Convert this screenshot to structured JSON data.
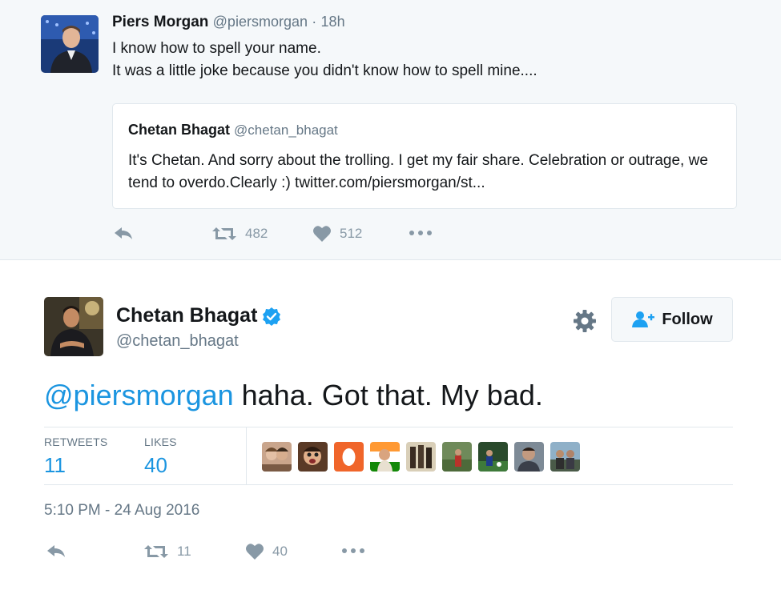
{
  "parent_tweet": {
    "author_name": "Piers Morgan",
    "author_handle": "@piersmorgan",
    "separator": "·",
    "time": "18h",
    "text_line1": "I know how to spell your name.",
    "text_line2": "It was a little joke because you didn't know how to spell mine....",
    "quoted": {
      "author_name": "Chetan Bhagat",
      "author_handle": "@chetan_bhagat",
      "text": "It's Chetan. And sorry about the trolling. I get my fair share. Celebration or outrage, we tend to overdo.Clearly :) twitter.com/piersmorgan/st..."
    },
    "actions": {
      "retweets": "482",
      "likes": "512"
    }
  },
  "focused_tweet": {
    "author_name": "Chetan Bhagat",
    "author_handle": "@chetan_bhagat",
    "verified": true,
    "follow_label": "Follow",
    "mention": "@piersmorgan",
    "text": " haha. Got that. My bad.",
    "stats": {
      "retweets_label": "RETWEETS",
      "retweets_count": "11",
      "likes_label": "LIKES",
      "likes_count": "40"
    },
    "timestamp": "5:10 PM - 24 Aug 2016",
    "actions": {
      "retweets": "11",
      "likes": "40"
    }
  },
  "icons": {
    "reply": "reply-icon",
    "retweet": "retweet-icon",
    "like": "heart-icon",
    "more": "more-icon",
    "settings": "gear-icon",
    "follow": "add-user-icon",
    "verified": "verified-badge-icon"
  },
  "colors": {
    "link_blue": "#1b95e0",
    "muted": "#657786",
    "icon_grey": "#8899a6",
    "verified_blue": "#1da1f2",
    "parent_bg": "#f5f8fa"
  }
}
